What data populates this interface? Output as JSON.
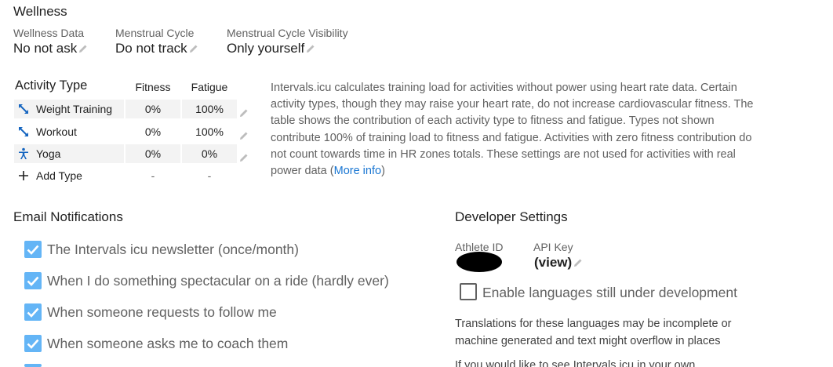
{
  "wellness": {
    "title": "Wellness",
    "fields": [
      {
        "label": "Wellness Data",
        "value": "No not ask"
      },
      {
        "label": "Menstrual Cycle",
        "value": "Do not track"
      },
      {
        "label": "Menstrual Cycle Visibility",
        "value": "Only yourself"
      }
    ]
  },
  "activity_types": {
    "title": "Activity Type",
    "col_fitness": "Fitness",
    "col_fatigue": "Fatigue",
    "rows": [
      {
        "name": "Weight Training",
        "fitness": "0%",
        "fatigue": "100%",
        "icon": "weight-training-icon"
      },
      {
        "name": "Workout",
        "fitness": "0%",
        "fatigue": "100%",
        "icon": "workout-icon"
      },
      {
        "name": "Yoga",
        "fitness": "0%",
        "fatigue": "0%",
        "icon": "yoga-icon"
      }
    ],
    "add_label": "Add Type",
    "add_fitness": "-",
    "add_fatigue": "-",
    "description": "Intervals.icu calculates training load for activities without power using heart rate data. Certain activity types, though they may raise your heart rate, do not increase cardiovascular fitness. The table shows the contribution of each activity type to fitness and fatigue. Types not shown contribute 100% of training load to fitness and fatigue. Activities with zero fitness contribution do not count towards time in HR zones totals. These settings are not used for activities with real power data (",
    "more_info": "More info",
    "description_end": ")"
  },
  "email": {
    "title": "Email Notifications",
    "options": [
      {
        "label": "The Intervals icu newsletter (once/month)",
        "checked": true
      },
      {
        "label": "When I do something spectacular on a ride (hardly ever)",
        "checked": true
      },
      {
        "label": "When someone requests to follow me",
        "checked": true
      },
      {
        "label": "When someone asks me to coach them",
        "checked": true
      }
    ]
  },
  "developer": {
    "title": "Developer Settings",
    "athlete_id_label": "Athlete ID",
    "api_key_label": "API Key",
    "api_key_value": "(view)",
    "enable_languages": "Enable languages still under development",
    "enable_languages_checked": false,
    "translations_note": "Translations for these languages may be incomplete or machine generated and text might overflow in places",
    "more_text": "If you would like to see Intervals.icu in your own"
  },
  "colors": {
    "accent": "#1976d2",
    "checkbox": "#64b5f6",
    "icon": "#1565c0"
  }
}
